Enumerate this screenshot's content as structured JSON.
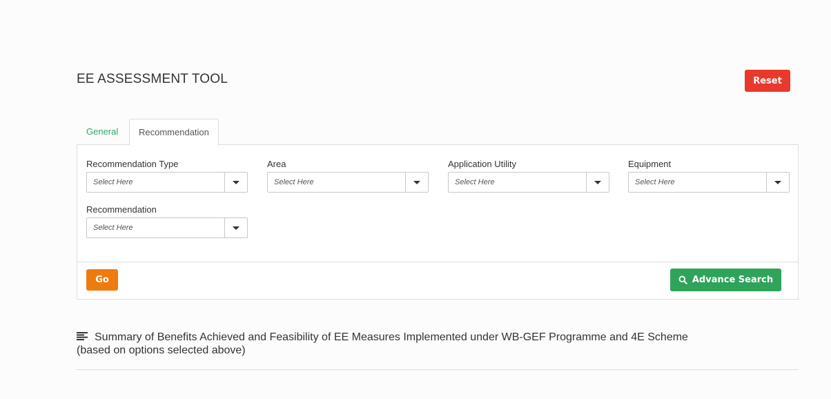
{
  "header": {
    "title": "EE ASSESSMENT TOOL",
    "reset_label": "Reset"
  },
  "tabs": [
    {
      "label": "General",
      "active": false
    },
    {
      "label": "Recommendation",
      "active": true
    }
  ],
  "filters": {
    "recommendation_type": {
      "label": "Recommendation Type",
      "value": "Select Here"
    },
    "area": {
      "label": "Area",
      "value": "Select Here"
    },
    "application_utility": {
      "label": "Application Utility",
      "value": "Select Here"
    },
    "equipment": {
      "label": "Equipment",
      "value": "Select Here"
    },
    "recommendation": {
      "label": "Recommendation",
      "value": "Select Here"
    }
  },
  "actions": {
    "go_label": "Go",
    "advance_search_label": "Advance Search"
  },
  "summary": {
    "line1": "Summary of Benefits Achieved and Feasibility of EE Measures Implemented under WB-GEF Programme and 4E Scheme",
    "line2": "(based on options selected above)"
  },
  "colors": {
    "reset": "#e8392c",
    "go": "#ee7b10",
    "advance_search": "#30a35a",
    "tab_general": "#34a36b"
  },
  "icons": {
    "summary": "align-left-icon",
    "advance_search": "search-icon",
    "dropdown": "caret-down-icon"
  }
}
